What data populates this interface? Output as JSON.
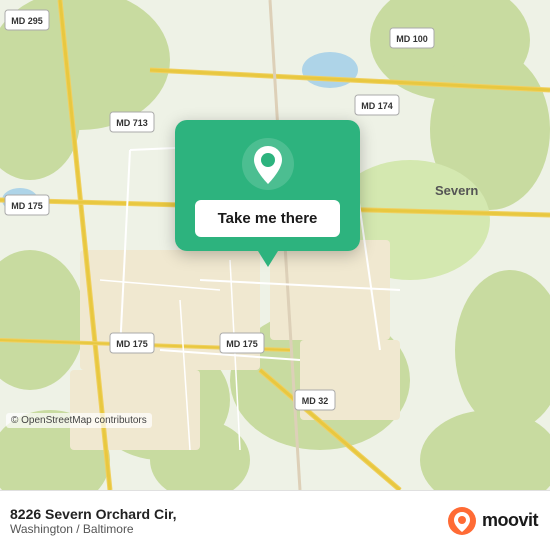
{
  "map": {
    "alt": "Map of 8226 Severn Orchard Cir area",
    "copyright": "© OpenStreetMap contributors"
  },
  "popup": {
    "button_label": "Take me there",
    "pin_icon": "location-pin-icon"
  },
  "footer": {
    "address": "8226 Severn Orchard Cir,",
    "city": "Washington / Baltimore",
    "brand": "moovit"
  },
  "road_labels": [
    "MD 295",
    "MD 100",
    "MD 713",
    "MD 174",
    "MD 175",
    "MD 32",
    "Severn"
  ]
}
